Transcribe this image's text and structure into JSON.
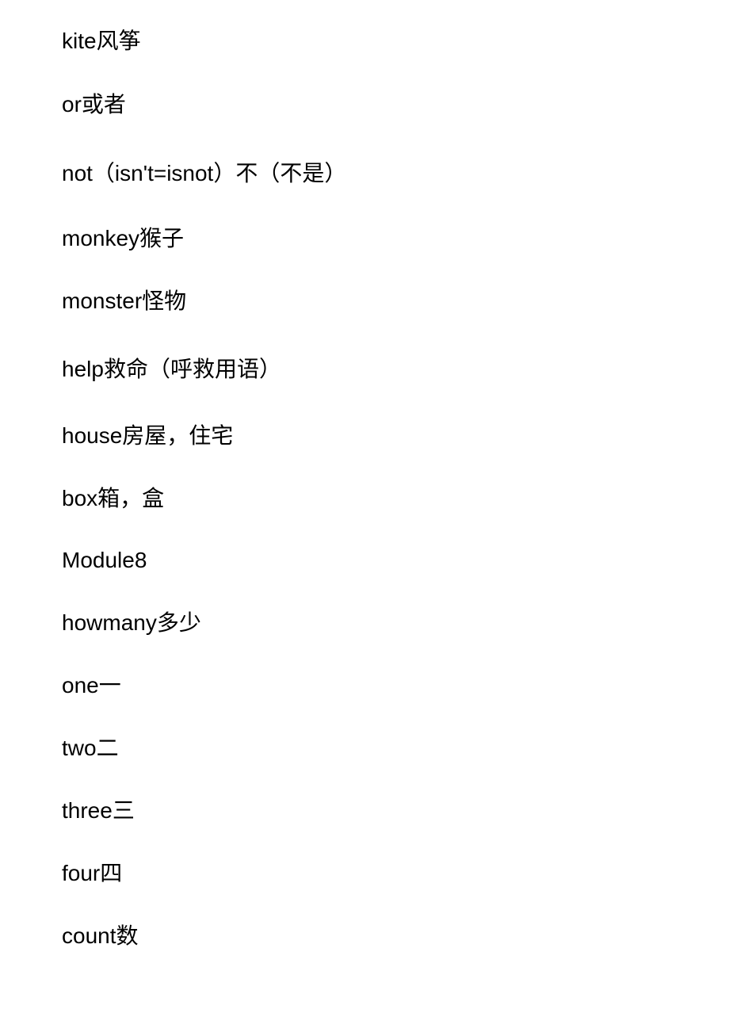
{
  "document": {
    "entries": [
      {
        "en": "kite",
        "zh": "风筝"
      },
      {
        "en": "or",
        "zh": "或者"
      },
      {
        "en": "not（isn't=isnot）",
        "zh": "不（不是）"
      },
      {
        "en": "monkey",
        "zh": "猴子"
      },
      {
        "en": "monster",
        "zh": "怪物"
      },
      {
        "en": "help",
        "zh": "救命（呼救用语）"
      },
      {
        "en": "house",
        "zh": "房屋，住宅"
      },
      {
        "en": "box",
        "zh": "箱，盒"
      },
      {
        "en": "Module8",
        "zh": ""
      },
      {
        "en": "howmany",
        "zh": "多少"
      },
      {
        "en": "one",
        "zh": "一"
      },
      {
        "en": "two",
        "zh": "二"
      },
      {
        "en": "three",
        "zh": "三"
      },
      {
        "en": "four",
        "zh": "四"
      },
      {
        "en": "count",
        "zh": "数"
      }
    ]
  }
}
